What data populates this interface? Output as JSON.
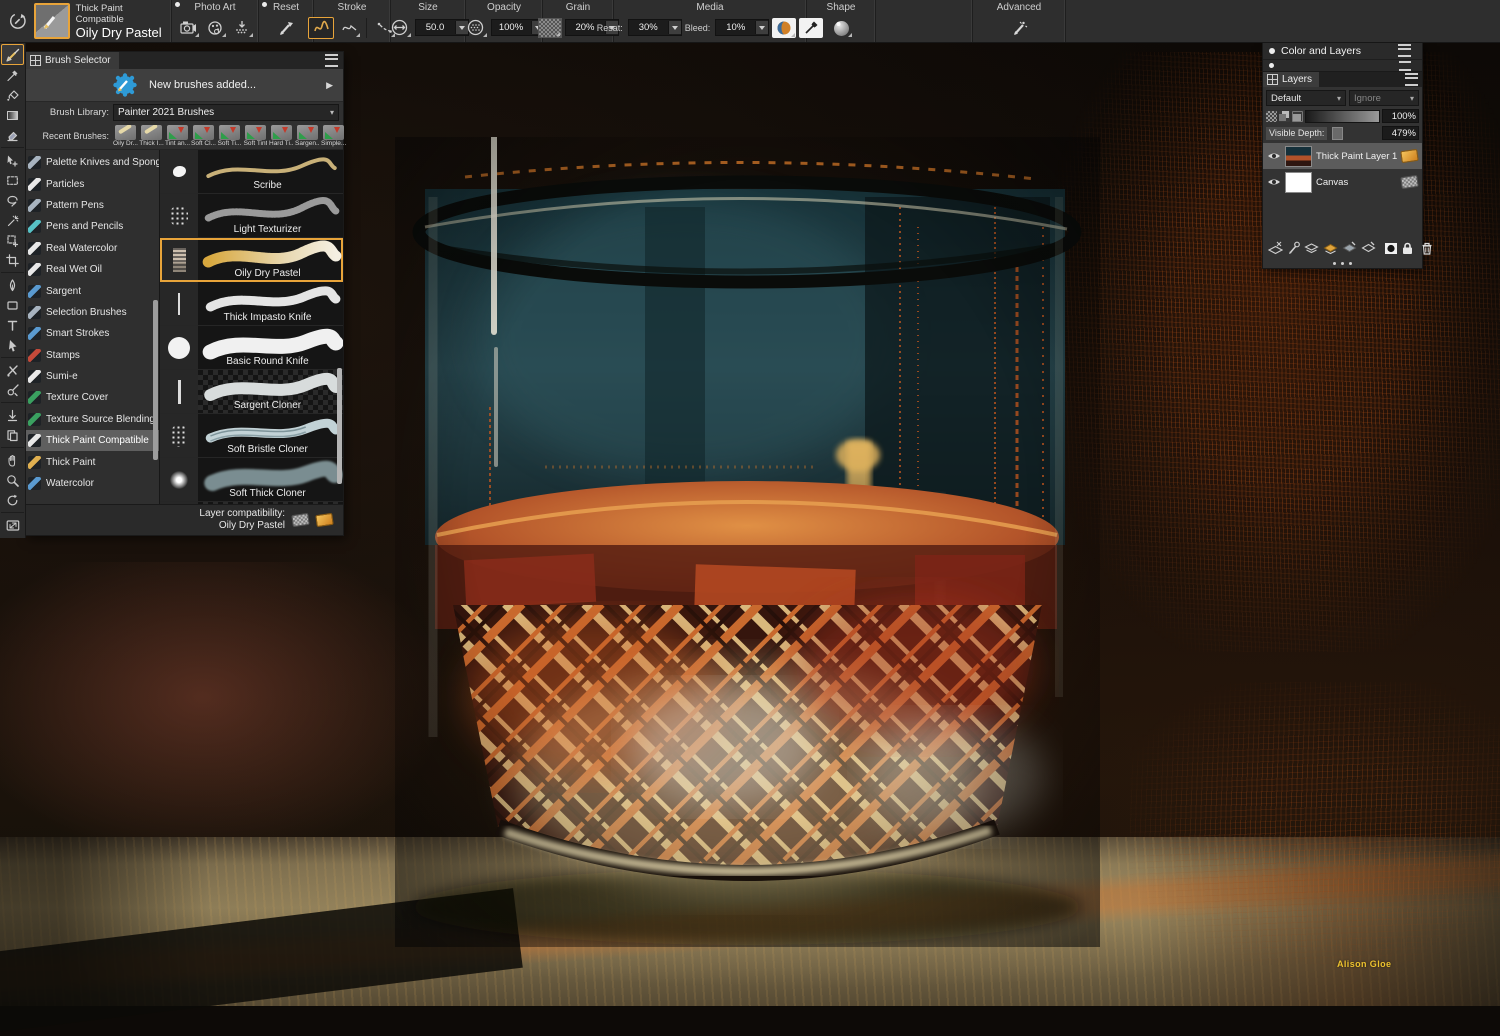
{
  "colors": {
    "accent_orange": "#e8a43a",
    "panel_bg": "#333333",
    "toolbar_bg": "#2e2e2e",
    "glass_teal": "#27464d",
    "liquid_amber": "#c06030",
    "table_olive": "#7d7050",
    "signature_yellow": "#edc22e"
  },
  "property_bar": {
    "preview": {
      "category": "Thick Paint Compatible",
      "variant": "Oily Dry Pastel"
    },
    "photo_art_label": "Photo Art",
    "reset_label": "Reset",
    "stroke_label": "Stroke",
    "size_label": "Size",
    "size_value": "50.0",
    "opacity_label": "Opacity",
    "opacity_value": "100%",
    "grain_label": "Grain",
    "grain_value": "20%",
    "media_label": "Media",
    "resat_label": "Resat:",
    "resat_value": "30%",
    "bleed_label": "Bleed:",
    "bleed_value": "10%",
    "shape_label": "Shape",
    "advanced_label": "Advanced"
  },
  "toolbox": {
    "tools": [
      "brush",
      "dropper",
      "paint-bucket",
      "gradient",
      "eraser",
      "layer-adjuster",
      "rect-select",
      "lasso",
      "magic-wand",
      "selection-adjuster",
      "crop",
      "pen",
      "rect-shape",
      "text",
      "shape-select",
      "shape-edit",
      "cloner-sampler",
      "drop-point",
      "clone-page",
      "grabber-hand",
      "magnifier",
      "rotate-page",
      "navigator"
    ]
  },
  "brush_selector": {
    "title": "Brush Selector",
    "notification": "New brushes added...",
    "play_icon": "▶",
    "caret_icon": "▾",
    "library_label": "Brush Library:",
    "library_value": "Painter 2021 Brushes",
    "recent_label": "Recent Brushes:",
    "recent": [
      {
        "label": "Oily Dr..."
      },
      {
        "label": "Thick I..."
      },
      {
        "label": "Tint an..."
      },
      {
        "label": "Soft Cl..."
      },
      {
        "label": "Soft Ti..."
      },
      {
        "label": "Soft Tint"
      },
      {
        "label": "Hard Ti..."
      },
      {
        "label": "Sargen..."
      },
      {
        "label": "Simple..."
      }
    ],
    "categories": [
      {
        "name": "Palette Knives and Sponges"
      },
      {
        "name": "Particles"
      },
      {
        "name": "Pattern Pens"
      },
      {
        "name": "Pens and Pencils"
      },
      {
        "name": "Real Watercolor"
      },
      {
        "name": "Real Wet Oil"
      },
      {
        "name": "Sargent"
      },
      {
        "name": "Selection Brushes"
      },
      {
        "name": "Smart Strokes"
      },
      {
        "name": "Stamps"
      },
      {
        "name": "Sumi-e"
      },
      {
        "name": "Texture Cover"
      },
      {
        "name": "Texture Source Blending"
      },
      {
        "name": "Thick Paint Compatible"
      },
      {
        "name": "Thick Paint"
      },
      {
        "name": "Watercolor"
      }
    ],
    "variants": [
      {
        "name": "Scribe"
      },
      {
        "name": "Light Texturizer"
      },
      {
        "name": "Oily Dry Pastel"
      },
      {
        "name": "Thick Impasto Knife"
      },
      {
        "name": "Basic Round Knife"
      },
      {
        "name": "Sargent Cloner"
      },
      {
        "name": "Soft Bristle Cloner"
      },
      {
        "name": "Soft Thick Cloner"
      },
      {
        "name": ""
      }
    ],
    "footer_label": "Layer compatibility:",
    "footer_value": "Oily Dry Pastel"
  },
  "layers_panel": {
    "header": "Color and Layers",
    "tab": "Layers",
    "blend_default": "Default",
    "blend_ignore": "Ignore",
    "caret_icon": "▾",
    "opacity_value": "100%",
    "depth_label": "Visible Depth:",
    "depth_value": "479%",
    "layers": [
      {
        "name": "Thick Paint Layer 1"
      },
      {
        "name": "Canvas"
      }
    ]
  },
  "canvas": {
    "signature": "Alison Gloe"
  }
}
